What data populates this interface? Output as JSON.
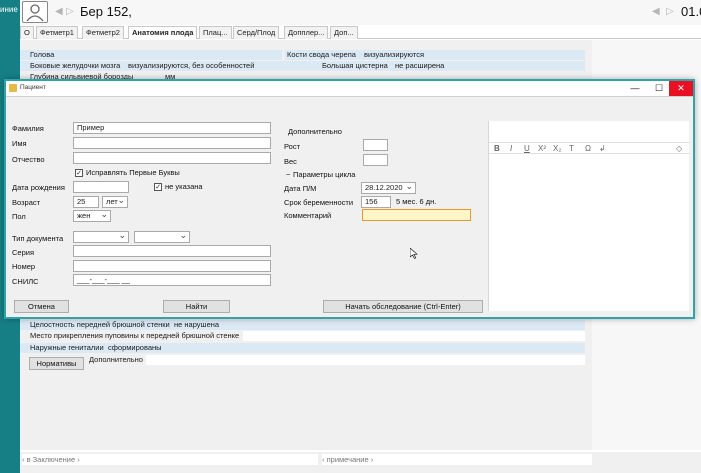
{
  "app": {
    "left_strip_text": "иние",
    "patient_title": "Бер 152,",
    "top_right_number": "01.0",
    "nav_prev": "◀",
    "nav_next": "▷",
    "right_prev": "◀",
    "right_next": "▷"
  },
  "tabs": [
    {
      "label": "О"
    },
    {
      "label": "Фетметр1"
    },
    {
      "label": "Фетметр2"
    },
    {
      "label": "Анатомия плода"
    },
    {
      "label": "Плац..."
    },
    {
      "label": "Серд/Плод"
    },
    {
      "label": "Допплер..."
    },
    {
      "label": "Доп..."
    }
  ],
  "background_form": {
    "rows": [
      {
        "label": "Голова",
        "value": ""
      },
      {
        "label": "Кости свода черепа",
        "value": "визуализируются"
      },
      {
        "label": "Боковые желудочки мозга",
        "value": "визуализируются, без особенностей"
      },
      {
        "label": "Большая цистерна",
        "value": "не расширена"
      },
      {
        "label": "Глубина сильвиевой борозды",
        "value": "мм"
      },
      {
        "label": "Целостность передней брюшной стенки",
        "value": "не нарушена"
      },
      {
        "label": "Место прикрепления пуповины к передней брюшной стенке",
        "value": ""
      },
      {
        "label": "Наружные гениталии",
        "value": "сформированы"
      }
    ],
    "normatives_button": "Нормативы",
    "additional_label": "Дополнительно",
    "conclusion_placeholder": "‹ в Заключение ›",
    "note_placeholder": "‹ примечание ›"
  },
  "dialog": {
    "title": "Пациент",
    "min_icon": "—",
    "max_icon": "☐",
    "close_icon": "✕",
    "surname_label": "Фамилия",
    "surname_value": "Пример",
    "name_label": "Имя",
    "name_value": "",
    "patronymic_label": "Отчество",
    "patronymic_value": "",
    "capitalize_checkbox_label": "Исправлять Первые Буквы",
    "capitalize_checked": true,
    "birthdate_label": "Дата рождения",
    "birthdate_value": "",
    "not_specified_label": "не указана",
    "not_specified_checked": true,
    "age_label": "Возраст",
    "age_value": "25",
    "age_unit": "лет",
    "sex_label": "Пол",
    "sex_value": "жен",
    "doc_type_label": "Тип документа",
    "doc_type_value": "",
    "doc_subtype_value": "",
    "series_label": "Серия",
    "series_value": "",
    "number_label": "Номер",
    "number_value": "",
    "snils_label": "СНИЛС",
    "snils_value": "___-___-___ __",
    "extra_label": "Дополнительно",
    "height_label": "Рост",
    "height_value": "",
    "weight_label": "Вес",
    "weight_value": "",
    "cycle_params_label": "Параметры цикла",
    "cycle_collapse_icon": "−",
    "lmp_date_label": "Дата П/М",
    "lmp_date_value": "28.12.2020",
    "gest_age_label": "Срок беременности",
    "gest_age_value": "156",
    "gest_age_text": "5 мес. 6 дн.",
    "comment_label": "Комментарий",
    "comment_value": "",
    "cancel_button": "Отмена",
    "find_button": "Найти",
    "start_exam_button": "Начать обследование  (Ctrl-Enter)",
    "rte_tools": [
      "B",
      "I",
      "U",
      "X²",
      "X₂",
      "T",
      "Ω",
      "↲"
    ],
    "rte_diamond": "◇"
  }
}
